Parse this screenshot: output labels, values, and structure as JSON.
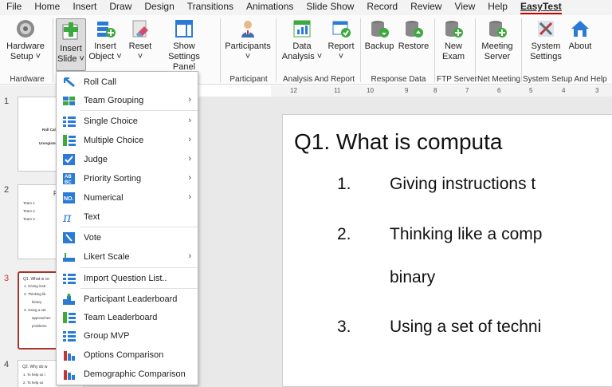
{
  "menu": [
    "File",
    "Home",
    "Insert",
    "Draw",
    "Design",
    "Transitions",
    "Animations",
    "Slide Show",
    "Record",
    "Review",
    "View",
    "Help",
    "EasyTest"
  ],
  "ribbon": {
    "hardware_setup": [
      "Hardware",
      "Setup ˅"
    ],
    "insert_slide": [
      "Insert",
      "Slide ˅"
    ],
    "insert_object": [
      "Insert",
      "Object ˅"
    ],
    "reset": [
      "Reset",
      "˅"
    ],
    "show_settings": [
      "Show",
      "Settings Panel"
    ],
    "participants": [
      "Participants",
      "˅"
    ],
    "data_analysis": [
      "Data",
      "Analysis ˅"
    ],
    "report": [
      "Report",
      "˅"
    ],
    "backup": "Backup",
    "restore": "Restore",
    "new_exam": [
      "New",
      "Exam"
    ],
    "meeting_server": [
      "Meeting",
      "Server"
    ],
    "system_settings": [
      "System",
      "Settings"
    ],
    "about": "About",
    "groups": [
      "Hardware",
      "Participant",
      "Analysis And Report",
      "Response Data",
      "FTP Server",
      "Net Meeting",
      "System Setup And Help"
    ]
  },
  "dropdown": [
    {
      "label": "Roll Call",
      "arrow": false,
      "icon": "roll-call-icon"
    },
    {
      "label": "Team Grouping",
      "arrow": true,
      "icon": "team-grouping-icon"
    },
    {
      "label": "Single Choice",
      "arrow": true,
      "icon": "single-choice-icon"
    },
    {
      "label": "Multiple Choice",
      "arrow": true,
      "icon": "multiple-choice-icon"
    },
    {
      "label": "Judge",
      "arrow": true,
      "icon": "judge-icon"
    },
    {
      "label": "Priority Sorting",
      "arrow": true,
      "icon": "priority-sorting-icon"
    },
    {
      "label": "Numerical",
      "arrow": true,
      "icon": "numerical-icon"
    },
    {
      "label": "Text",
      "arrow": false,
      "icon": "text-pi-icon"
    },
    {
      "label": "Vote",
      "arrow": false,
      "icon": "vote-icon"
    },
    {
      "label": "Likert Scale",
      "arrow": true,
      "icon": "likert-scale-icon"
    },
    {
      "label": "Import Question List..",
      "arrow": false,
      "icon": "import-list-icon"
    },
    {
      "label": "Participant Leaderboard",
      "arrow": false,
      "icon": "participant-leaderboard-icon"
    },
    {
      "label": "Team Leaderboard",
      "arrow": false,
      "icon": "team-leaderboard-icon"
    },
    {
      "label": "Group MVP",
      "arrow": false,
      "icon": "group-mvp-icon"
    },
    {
      "label": "Options Comparison",
      "arrow": false,
      "icon": "options-comparison-icon"
    },
    {
      "label": "Demographic Comparison",
      "arrow": false,
      "icon": "demographic-comparison-icon"
    }
  ],
  "ruler": [
    "12",
    "11",
    "10",
    "9",
    "8",
    "7",
    "6",
    "5",
    "4",
    "3"
  ],
  "slides": [
    {
      "num": "1",
      "lines": [
        "Roll Call",
        "Unregistered"
      ]
    },
    {
      "num": "2",
      "title": "P",
      "lines": [
        "Team 1",
        "Team 2",
        "Team 3"
      ]
    },
    {
      "num": "3",
      "lines": [
        "Q1. What is co",
        "1.   Giving instr",
        "2.   Thinking lik",
        "binary",
        "3.   Using a set",
        "approaches",
        "problems"
      ]
    },
    {
      "num": "4",
      "lines": [
        "Q2. Why do w",
        "1.   To help us i",
        "2.   To help us"
      ]
    }
  ],
  "slide": {
    "question": "Q1. What is computa",
    "items": [
      {
        "num": "1.",
        "text": "Giving instructions t"
      },
      {
        "num": "2.",
        "text": "Thinking like a comp"
      },
      {
        "num": "",
        "text": "binary"
      },
      {
        "num": "3.",
        "text": "Using a set of techni"
      }
    ]
  },
  "colors": {
    "accent": "#a8342a",
    "blue": "#2b7bd6",
    "green": "#3caa3c"
  }
}
